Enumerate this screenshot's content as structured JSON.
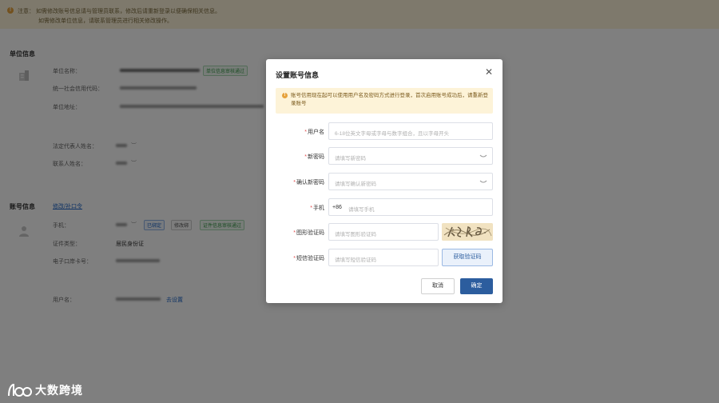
{
  "notice": {
    "line1": "注意：  如需修改账号信息请与管理员联系，修改后请重新登录以便确保相关信息。",
    "line2": "如需修改单位信息，请联系管理员进行相关修改操作。"
  },
  "unit_section": {
    "title": "单位信息",
    "label_name": "单位名称：",
    "label_credit_code": "统一社会信用代码：",
    "label_address": "单位地址：",
    "badge_verified": "单位信息审核通过",
    "label_legal_person": "法定代表人姓名：",
    "label_contact": "联系人姓名："
  },
  "account_section": {
    "title": "账号信息",
    "modify_link": "修改/补口令",
    "label_phone": "手机：",
    "tag_bound": "已绑定",
    "tag_change": "修改绑",
    "tag_verified": "证件信息审核通过",
    "label_id_type": "证件类型：",
    "id_type_value": "居民身份证",
    "label_email": "电子口岸卡号：",
    "label_username": "用户名：",
    "set_link": "去设置"
  },
  "modal": {
    "title": "设置账号信息",
    "close_icon": "close-icon",
    "alert_text": "账号信用现在起可以使用用户名及密码方式进行登录，首次启用账号成功后，请重新登录账号",
    "fields": {
      "username": {
        "label": "用户名",
        "placeholder": "6-18位英文字母或字母与数字组合，且以字母开头"
      },
      "new_password": {
        "label": "新密码",
        "placeholder": "请填写新密码"
      },
      "confirm_password": {
        "label": "确认新密码",
        "placeholder": "请填写确认新密码"
      },
      "phone": {
        "label": "手机",
        "prefix": "+86",
        "placeholder": "请填写手机"
      },
      "captcha": {
        "label": "图形验证码",
        "placeholder": "请填写图形验证码"
      },
      "sms_code": {
        "label": "短信验证码",
        "placeholder": "请填写短信验证码",
        "button": "获取验证码"
      }
    },
    "cancel_label": "取消",
    "confirm_label": "确定"
  },
  "watermark": {
    "text": "大数跨境"
  },
  "colors": {
    "primary": "#2c5d9e",
    "warning": "#e6a23c",
    "alert_bg": "#fdf3d8",
    "required": "#e34d4d"
  }
}
